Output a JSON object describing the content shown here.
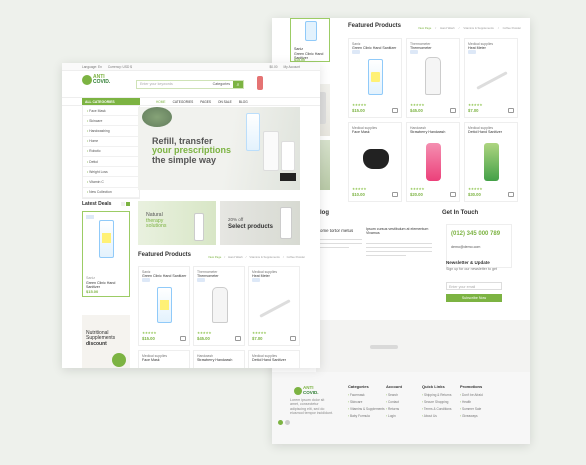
{
  "brand": {
    "name_top": "ANTI",
    "name_bottom": "COVID."
  },
  "front": {
    "topbar": {
      "language": "Language: En",
      "currency": "Currency: USD $",
      "account": "My Account",
      "cart_total": "$0.00"
    },
    "search": {
      "placeholder": "Enter your keywords",
      "category": "Categories"
    },
    "nav": [
      "HOME",
      "CATEGORIES",
      "PAGES",
      "ON SALE",
      "BLOG"
    ],
    "sidebar": {
      "title": "ALL CATEGORIES",
      "items": [
        "Face Mask",
        "Skincare",
        "Handwashing",
        "Home",
        "Robotic",
        "Dettol",
        "Weight Loss",
        "Vitamin C",
        "New Collection"
      ]
    },
    "hero": {
      "line1": "Refill, transfer",
      "line2": "your",
      "line3": "prescriptions",
      "line4": "the simple way"
    },
    "banner1": {
      "line1": "Natural",
      "line2": "therapy",
      "line3": "solutions"
    },
    "banner2": {
      "pct": "20% off",
      "text": "Select products"
    },
    "latest_deals": {
      "title": "Latest Deals",
      "product": {
        "category": "Saniz",
        "name": "Green Clinic Hand Sanitizer",
        "price": "$15.00"
      }
    },
    "promo": {
      "line1": "Nutritional",
      "line2": "Supplements",
      "line3": "discount"
    },
    "featured": {
      "title": "Featured Products",
      "tabs": [
        "View Page",
        "Hand Wash",
        "Vitamins & Supplements",
        "Coffee Powder"
      ],
      "products": [
        {
          "category": "Saniz",
          "name": "Green Clinic Hand Sanitizer",
          "price": "$15.00"
        },
        {
          "category": "Thermometer",
          "name": "Thermometer",
          "price": "$45.00"
        },
        {
          "category": "Medical supplies",
          "name": "Heat Meter",
          "price": "$7.00"
        }
      ],
      "row2": [
        {
          "category": "Medical supplies",
          "name": "Face Mask"
        },
        {
          "category": "Handwash",
          "name": "Strawberry Handwash"
        },
        {
          "category": "Medical supplies",
          "name": "Dettol Hand Sanitizer"
        }
      ]
    }
  },
  "back": {
    "featured": {
      "title": "Featured Products",
      "tabs": [
        "View Page",
        "Hand Wash",
        "Vitamins & Supplements",
        "Coffee Powder"
      ],
      "row1": [
        {
          "category": "Saniz",
          "name": "Green Clinic Hand Sanitizer",
          "price": "$15.00"
        },
        {
          "category": "Thermometer",
          "name": "Thermometer",
          "price": "$45.00"
        },
        {
          "category": "Medical supplies",
          "name": "Heat Meter",
          "price": "$7.00"
        }
      ],
      "row2": [
        {
          "category": "Medical supplies",
          "name": "Face Mask",
          "price": "$10.00"
        },
        {
          "category": "Handwash",
          "name": "Strawberry Handwash",
          "price": "$20.00"
        },
        {
          "category": "Medical supplies",
          "name": "Dettol Hand Sanitizer",
          "price": "$30.00"
        }
      ]
    },
    "blog": {
      "title": "log",
      "post1": "ome tortor metus",
      "post2_a": "Ipsum cursus vestibulum at elementum",
      "post2_b": "Vivamus"
    },
    "contact": {
      "title": "Get In Touch",
      "phone": "(012) 345 000 789",
      "email": "demo@demo.com"
    },
    "newsletter": {
      "title": "Newsletter & Update",
      "text": "Sign up for our newsletter to get",
      "placeholder": "Enter your email",
      "button": "Subscribe Now"
    },
    "footer": {
      "about": "Lorem ipsum dolor sit amet, consectetur adipiscing elit, sed do eiusmod tempor incididunt.",
      "columns": [
        {
          "title": "Categories",
          "items": [
            "Facemask",
            "Skincare",
            "Vitamins & Supplements",
            "Baby Formula"
          ]
        },
        {
          "title": "Account",
          "items": [
            "Search",
            "Contact",
            "Returns",
            "Login"
          ]
        },
        {
          "title": "Quick Links",
          "items": [
            "Shipping & Returns",
            "Secure Shopping",
            "Terms & Conditions",
            "About Us"
          ]
        },
        {
          "title": "Promotions",
          "items": [
            "Don't be Afraid",
            "Health",
            "Summer Sale",
            "Giveaways"
          ]
        }
      ]
    }
  },
  "colors": {
    "accent": "#7cb342",
    "background": "#eef1ec"
  }
}
